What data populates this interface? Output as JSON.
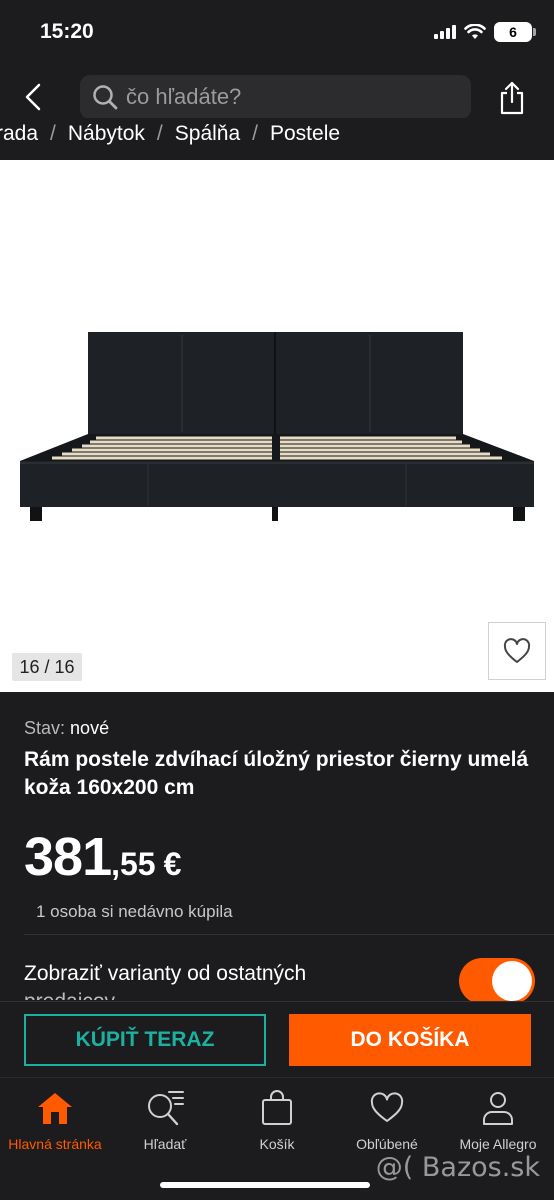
{
  "status": {
    "time": "15:20",
    "battery": "6"
  },
  "search": {
    "placeholder": "čo hľadáte?"
  },
  "breadcrumb": [
    "rada",
    "Nábytok",
    "Spálňa",
    "Postele"
  ],
  "gallery": {
    "counter": "16 / 16"
  },
  "product": {
    "condition_label": "Stav:",
    "condition_value": "nové",
    "title": "Rám postele zdvíhací úložný priestor čierny umelá koža 160x200 cm",
    "price_int": "381",
    "price_dec": ",55",
    "price_currency": "€",
    "recent": "1 osoba si nedávno kúpila",
    "variants_line1": "Zobraziť varianty od ostatných",
    "variants_line2": "predajcov",
    "variants_enabled": true
  },
  "actions": {
    "buy_now": "KÚPIŤ TERAZ",
    "add_to_cart": "DO KOŠÍKA"
  },
  "tabs": [
    {
      "label": "Hlavná stránka",
      "icon": "home-icon",
      "active": true
    },
    {
      "label": "Hľadať",
      "icon": "search-list-icon",
      "active": false
    },
    {
      "label": "Košík",
      "icon": "bag-icon",
      "active": false
    },
    {
      "label": "Obľúbené",
      "icon": "heart-icon",
      "active": false
    },
    {
      "label": "Moje Allegro",
      "icon": "user-icon",
      "active": false
    }
  ],
  "watermark": "@( Bazos.sk",
  "colors": {
    "accent": "#ff5a00",
    "teal": "#1bb0a0",
    "background": "#1c1c1e"
  }
}
